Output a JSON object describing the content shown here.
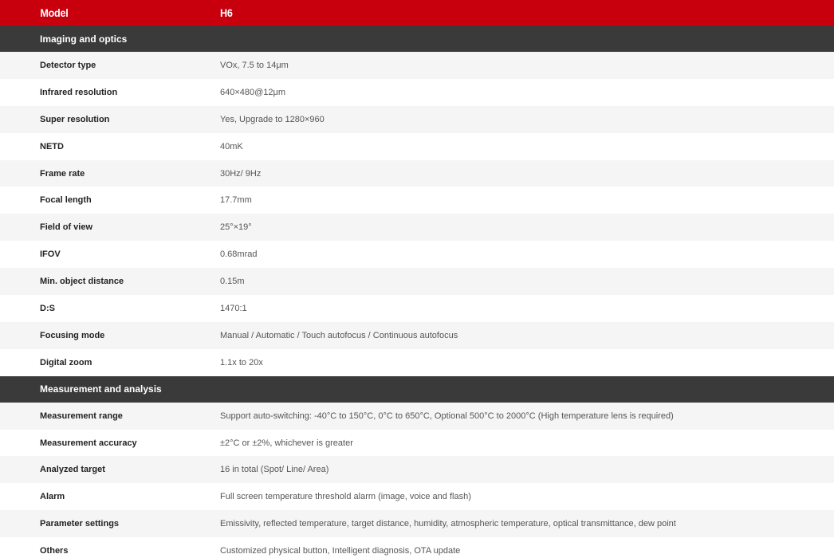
{
  "header": {
    "label": "Model",
    "value": "H6"
  },
  "colors": {
    "header_bg": "#c8000e",
    "section_bg": "#3a3a3a",
    "row_alt_bg": "#f5f5f5"
  },
  "sections": [
    {
      "title": "Imaging and optics",
      "rows": [
        {
          "label": "Detector type",
          "value": "VOx, 7.5 to 14μm"
        },
        {
          "label": "Infrared resolution",
          "value": "640×480@12μm"
        },
        {
          "label": "Super resolution",
          "value": "Yes, Upgrade to 1280×960"
        },
        {
          "label": "NETD",
          "value": "40mK"
        },
        {
          "label": "Frame rate",
          "value": "30Hz/ 9Hz"
        },
        {
          "label": "Focal length",
          "value": "17.7mm"
        },
        {
          "label": "Field of view",
          "value": "25°×19°"
        },
        {
          "label": "IFOV",
          "value": "0.68mrad"
        },
        {
          "label": "Min. object distance",
          "value": "0.15m"
        },
        {
          "label": "D:S",
          "value": "1470:1"
        },
        {
          "label": "Focusing mode",
          "value": "Manual / Automatic / Touch autofocus / Continuous autofocus"
        },
        {
          "label": "Digital zoom",
          "value": "1.1x to 20x"
        }
      ]
    },
    {
      "title": "Measurement and analysis",
      "rows": [
        {
          "label": "Measurement range",
          "value": "Support auto-switching: -40°C to 150°C, 0°C to 650°C, Optional 500°C to 2000°C (High temperature lens is required)"
        },
        {
          "label": "Measurement accuracy",
          "value": "±2°C or ±2%, whichever is greater"
        },
        {
          "label": "Analyzed target",
          "value": "16 in total (Spot/ Line/ Area)"
        },
        {
          "label": "Alarm",
          "value": "Full screen temperature threshold alarm (image, voice and flash)"
        },
        {
          "label": "Parameter settings",
          "value": "Emissivity, reflected temperature, target distance, humidity, atmospheric temperature, optical transmittance, dew point"
        },
        {
          "label": "Others",
          "value": "Customized physical button, Intelligent diagnosis, OTA update"
        }
      ]
    }
  ]
}
